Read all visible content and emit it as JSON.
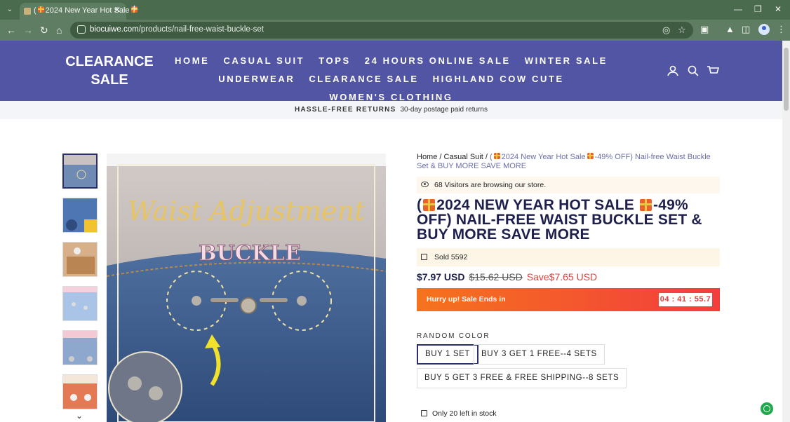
{
  "browser": {
    "tab_title": "2024 New Year Hot Sale",
    "new_tab": "+",
    "url_host": "biocuiwe.com",
    "url_path": "/products/nail-free-waist-buckle-set"
  },
  "site": {
    "logo_line1": "CLEARANCE",
    "logo_line2": "SALE",
    "nav": [
      "HOME",
      "CASUAL SUIT",
      "TOPS",
      "24 HOURS ONLINE SALE",
      "WINTER SALE",
      "UNDERWEAR",
      "CLEARANCE SALE",
      "HIGHLAND COW CUTE",
      "WOMEN'S CLOTHING"
    ],
    "brand_color": "#5255a4"
  },
  "announcement": {
    "bold": "HASSLE-FREE RETURNS",
    "text": "30-day postage paid returns"
  },
  "gallery": {
    "hero_title": "Waist Adjustment",
    "hero_subtitle": "BUCKLE"
  },
  "breadcrumb": {
    "home": "Home",
    "sep": "/",
    "category": "Casual Suit",
    "current_pre": "(",
    "current_post": "2024 New Year Hot Sale",
    "current_tail": "-49% OFF) Nail-free Waist Buckle Set & BUY MORE SAVE MORE"
  },
  "visitors": "68 Visitors are browsing our store.",
  "title": {
    "open": "(",
    "part1": "2024 NEW YEAR HOT SALE",
    "part2": "-49% OFF) NAIL-FREE WAIST BUCKLE SET & BUY MORE SAVE MORE"
  },
  "sold": "Sold 5592",
  "price": {
    "now": "$7.97 USD",
    "was": "$15.62 USD",
    "save": "Save$7.65 USD"
  },
  "countdown": {
    "label": "Hurry up! Sale Ends in",
    "time": "04 : 41 : 55.7"
  },
  "options": {
    "label": "RANDOM COLOR",
    "variants": [
      "BUY 1 SET",
      "BUY 3 GET 1 FREE--4 SETS",
      "BUY 5 GET 3 FREE & FREE SHIPPING--8 SETS"
    ],
    "selected": 0
  },
  "stock": "Only 20 left in stock"
}
